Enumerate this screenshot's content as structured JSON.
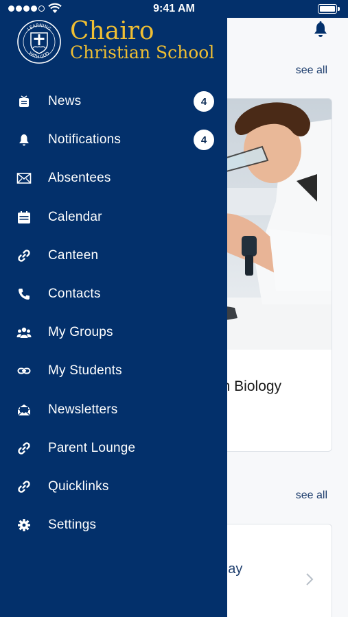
{
  "status_bar": {
    "time": "9:41 AM",
    "signal_icon": "signal-dots-icon",
    "wifi_icon": "wifi-icon",
    "battery_icon": "battery-icon"
  },
  "colors": {
    "drawer_bg": "#03306b",
    "school_name": "#f0bf33",
    "badge_bg": "#ffffff",
    "accent_text": "#1f3f6e"
  },
  "school": {
    "name_line1": "Chairo",
    "name_line2": "Christian School",
    "logo_icon": "school-crest-icon",
    "crest_motto_top": "LEARNING",
    "crest_motto_bottom": "WITH GOD"
  },
  "menu": {
    "items": [
      {
        "label": "News",
        "icon": "tv-icon",
        "badge": "4"
      },
      {
        "label": "Notifications",
        "icon": "bell-icon",
        "badge": "4"
      },
      {
        "label": "Absentees",
        "icon": "envelope-icon"
      },
      {
        "label": "Calendar",
        "icon": "calendar-icon"
      },
      {
        "label": "Canteen",
        "icon": "link-icon"
      },
      {
        "label": "Contacts",
        "icon": "phone-icon"
      },
      {
        "label": "My Groups",
        "icon": "group-icon"
      },
      {
        "label": "My Students",
        "icon": "chain-link-icon"
      },
      {
        "label": "Newsletters",
        "icon": "open-envelope-icon"
      },
      {
        "label": "Parent Lounge",
        "icon": "link-icon"
      },
      {
        "label": "Quicklinks",
        "icon": "link-icon"
      },
      {
        "label": "Settings",
        "icon": "gear-icon"
      }
    ]
  },
  "background": {
    "bell_icon": "bell-icon",
    "see_all_1": "see all",
    "card_title": "with Biology",
    "see_all_2": "see all",
    "card2_title": "y May",
    "chevron_icon": "chevron-right-icon"
  }
}
